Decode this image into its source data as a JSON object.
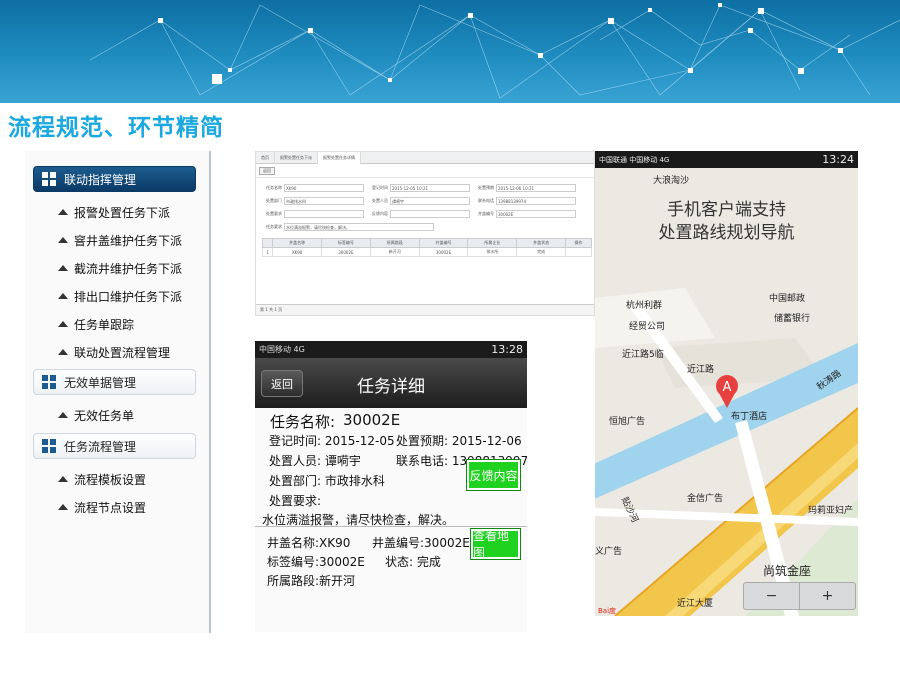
{
  "slide": {
    "title": "流程规范、环节精简"
  },
  "sidebar": {
    "groups": [
      {
        "label": "联动指挥管理",
        "active": true,
        "items": [
          "报警处置任务下派",
          "窨井盖维护任务下派",
          "截流井维护任务下派",
          "排出口维护任务下派",
          "任务单跟踪",
          "联动处置流程管理"
        ]
      },
      {
        "label": "无效单据管理",
        "active": false,
        "items": [
          "无效任务单"
        ]
      },
      {
        "label": "任务流程管理",
        "active": false,
        "items": [
          "流程模板设置",
          "流程节点设置"
        ]
      }
    ]
  },
  "web": {
    "tabs": [
      "首页",
      "报警处置任务下派",
      "报警处置任务详情"
    ],
    "button": "返回",
    "fields": [
      [
        "任务名称",
        "XK90",
        "登记时间",
        "2015-12-05 10:21",
        "处置预期",
        "2015-12-06 10:21"
      ],
      [
        "处置部门",
        "市政排水科",
        "处置人员",
        "谭嗬宇",
        "联系电话",
        "13988139974"
      ],
      [
        "处置要求",
        "",
        "反馈内容",
        "",
        "井盖编号",
        "30002E"
      ]
    ],
    "desc_label": "任务要求",
    "desc": "水位满溢报警，请尽快检查，解决。",
    "table_headers": [
      "",
      "井盖名称",
      "标签编号",
      "所属路段",
      "井盖编号",
      "所属企业",
      "井盖状态",
      "操作"
    ],
    "table_row": [
      "1",
      "XK90",
      "30002E",
      "新开河",
      "30002E",
      "排水所",
      "完成",
      ""
    ],
    "pager": "第 1 共 1 页"
  },
  "phone1": {
    "time": "13:28",
    "carrier": "中国移动 4G",
    "back": "返回",
    "title": "任务详细",
    "task_name_label": "任务名称:",
    "task_name": "30002E",
    "reg_time": "登记时间: 2015-12-05",
    "deadline": "处置预期: 2015-12-06",
    "person": "处置人员: 谭嗬宇",
    "phone": "联系电话: 13988139974",
    "dept": "处置部门: 市政排水科",
    "requirement": "处置要求:",
    "message": "水位满溢报警，请尽快检查，解决。",
    "feedback_btn": "反馈内容",
    "well_name": "井盖名称:XK90",
    "well_code": "井盖编号:30002E",
    "tag_code": "标签编号:30002E",
    "status": "状态:    完成",
    "road": "所属路段:新开河",
    "map_btn": "查看地图"
  },
  "phone2": {
    "carrier": "中国联通 中国移动 4G",
    "time": "13:24",
    "caption_line1": "手机客户端支持",
    "caption_line2": "处置路线规划导航",
    "labels": {
      "l1": "大浪淘沙",
      "l2": "杭州利群",
      "l3": "经贸公司",
      "l4": "近江路5临",
      "l5": "中国邮政",
      "l6": "储蓄银行",
      "l7": "近江路",
      "l8": "恒旭广告",
      "l9": "布丁酒店",
      "l10": "秋涛路",
      "l11": "贴沙河",
      "l12": "金信广告",
      "l13": "玛莉亚妇产",
      "l14": "义广告",
      "l15": "尚筑金座",
      "l16": "近江大厦",
      "l17": "Bai度"
    },
    "marker": "A",
    "zoom_out": "−",
    "zoom_in": "+"
  },
  "colors": {
    "title": "#19a8df",
    "banner": "#1780b6",
    "active_group": "#0b3a66",
    "green_button": "#1fd21f",
    "road_blue": "#9fd3ee",
    "road_yellow": "#f2c64a"
  }
}
